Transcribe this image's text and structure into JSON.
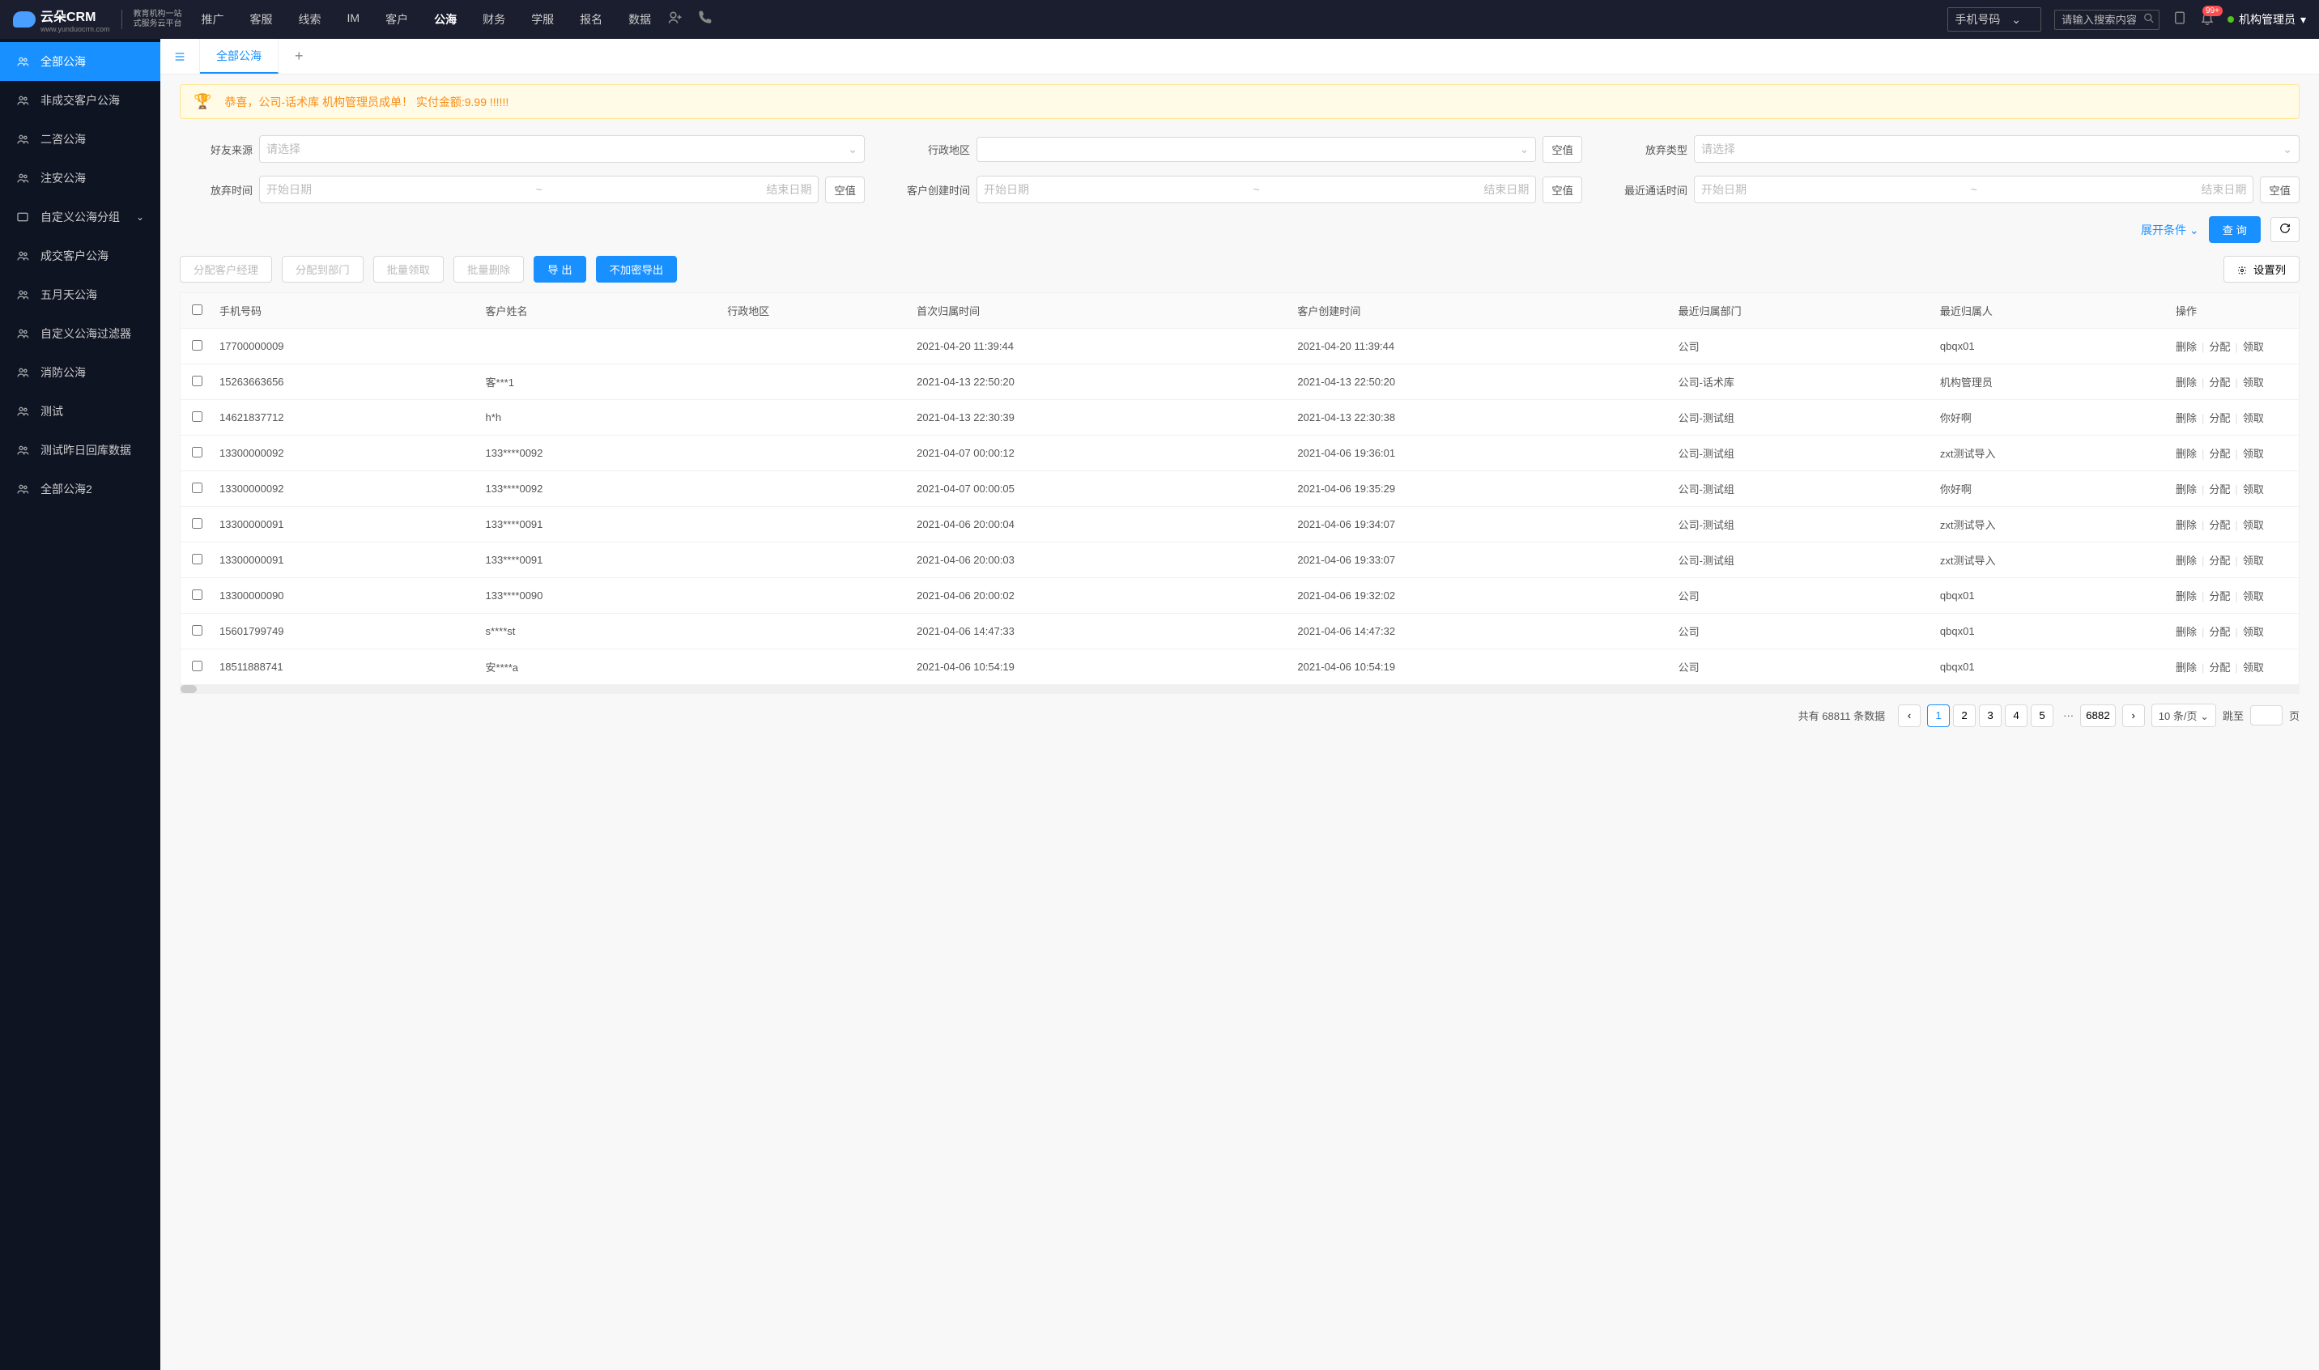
{
  "header": {
    "logo": "云朵CRM",
    "logo_url": "www.yunduocrm.com",
    "logo_sub1": "教育机构一站",
    "logo_sub2": "式服务云平台",
    "nav": [
      "推广",
      "客服",
      "线索",
      "IM",
      "客户",
      "公海",
      "财务",
      "学服",
      "报名",
      "数据"
    ],
    "nav_active_index": 5,
    "search_type": "手机号码",
    "search_placeholder": "请输入搜索内容",
    "notif_count": "99+",
    "user_name": "机构管理员"
  },
  "sidebar": {
    "items": [
      {
        "label": "全部公海",
        "active": true
      },
      {
        "label": "非成交客户公海"
      },
      {
        "label": "二咨公海"
      },
      {
        "label": "注安公海"
      },
      {
        "label": "自定义公海分组",
        "has_children": true
      },
      {
        "label": "成交客户公海"
      },
      {
        "label": "五月天公海"
      },
      {
        "label": "自定义公海过滤器"
      },
      {
        "label": "消防公海"
      },
      {
        "label": "测试"
      },
      {
        "label": "测试昨日回库数据"
      },
      {
        "label": "全部公海2"
      }
    ]
  },
  "tabs": {
    "items": [
      "全部公海"
    ],
    "active_index": 0
  },
  "alert": {
    "text": "恭喜，公司-话术库  机构管理员成单！  实付金额:9.99 !!!!!!"
  },
  "filters": {
    "friend_source": {
      "label": "好友来源",
      "placeholder": "请选择"
    },
    "region": {
      "label": "行政地区",
      "placeholder": "",
      "null_btn": "空值"
    },
    "abandon_type": {
      "label": "放弃类型",
      "placeholder": "请选择"
    },
    "abandon_time": {
      "label": "放弃时间",
      "start": "开始日期",
      "end": "结束日期",
      "null_btn": "空值"
    },
    "create_time": {
      "label": "客户创建时间",
      "start": "开始日期",
      "end": "结束日期",
      "null_btn": "空值"
    },
    "last_call_time": {
      "label": "最近通话时间",
      "start": "开始日期",
      "end": "结束日期",
      "null_btn": "空值"
    }
  },
  "actions": {
    "expand": "展开条件",
    "query": "查 询"
  },
  "toolbar": {
    "assign_manager": "分配客户经理",
    "assign_dept": "分配到部门",
    "batch_claim": "批量领取",
    "batch_delete": "批量删除",
    "export": "导 出",
    "export_plain": "不加密导出",
    "set_columns": "设置列"
  },
  "table": {
    "columns": [
      "手机号码",
      "客户姓名",
      "行政地区",
      "首次归属时间",
      "客户创建时间",
      "最近归属部门",
      "最近归属人",
      "操作"
    ],
    "op_labels": {
      "delete": "删除",
      "assign": "分配",
      "claim": "领取"
    },
    "rows": [
      {
        "phone": "17700000009",
        "name": "",
        "region": "",
        "first_time": "2021-04-20 11:39:44",
        "create_time": "2021-04-20 11:39:44",
        "dept": "公司",
        "owner": "qbqx01"
      },
      {
        "phone": "15263663656",
        "name": "客***1",
        "region": "",
        "first_time": "2021-04-13 22:50:20",
        "create_time": "2021-04-13 22:50:20",
        "dept": "公司-话术库",
        "owner": "机构管理员"
      },
      {
        "phone": "14621837712",
        "name": "h*h",
        "region": "",
        "first_time": "2021-04-13 22:30:39",
        "create_time": "2021-04-13 22:30:38",
        "dept": "公司-测试组",
        "owner": "你好啊"
      },
      {
        "phone": "13300000092",
        "name": "133****0092",
        "region": "",
        "first_time": "2021-04-07 00:00:12",
        "create_time": "2021-04-06 19:36:01",
        "dept": "公司-测试组",
        "owner": "zxt测试导入"
      },
      {
        "phone": "13300000092",
        "name": "133****0092",
        "region": "",
        "first_time": "2021-04-07 00:00:05",
        "create_time": "2021-04-06 19:35:29",
        "dept": "公司-测试组",
        "owner": "你好啊"
      },
      {
        "phone": "13300000091",
        "name": "133****0091",
        "region": "",
        "first_time": "2021-04-06 20:00:04",
        "create_time": "2021-04-06 19:34:07",
        "dept": "公司-测试组",
        "owner": "zxt测试导入"
      },
      {
        "phone": "13300000091",
        "name": "133****0091",
        "region": "",
        "first_time": "2021-04-06 20:00:03",
        "create_time": "2021-04-06 19:33:07",
        "dept": "公司-测试组",
        "owner": "zxt测试导入"
      },
      {
        "phone": "13300000090",
        "name": "133****0090",
        "region": "",
        "first_time": "2021-04-06 20:00:02",
        "create_time": "2021-04-06 19:32:02",
        "dept": "公司",
        "owner": "qbqx01"
      },
      {
        "phone": "15601799749",
        "name": "s****st",
        "region": "",
        "first_time": "2021-04-06 14:47:33",
        "create_time": "2021-04-06 14:47:32",
        "dept": "公司",
        "owner": "qbqx01"
      },
      {
        "phone": "18511888741",
        "name": "安****a",
        "region": "",
        "first_time": "2021-04-06 10:54:19",
        "create_time": "2021-04-06 10:54:19",
        "dept": "公司",
        "owner": "qbqx01"
      }
    ]
  },
  "pagination": {
    "total_prefix": "共有",
    "total_count": "68811",
    "total_suffix": "条数据",
    "pages": [
      "1",
      "2",
      "3",
      "4",
      "5"
    ],
    "ellipsis": "···",
    "last_page": "6882",
    "page_size": "10 条/页",
    "jump_label": "跳至",
    "jump_suffix": "页"
  }
}
